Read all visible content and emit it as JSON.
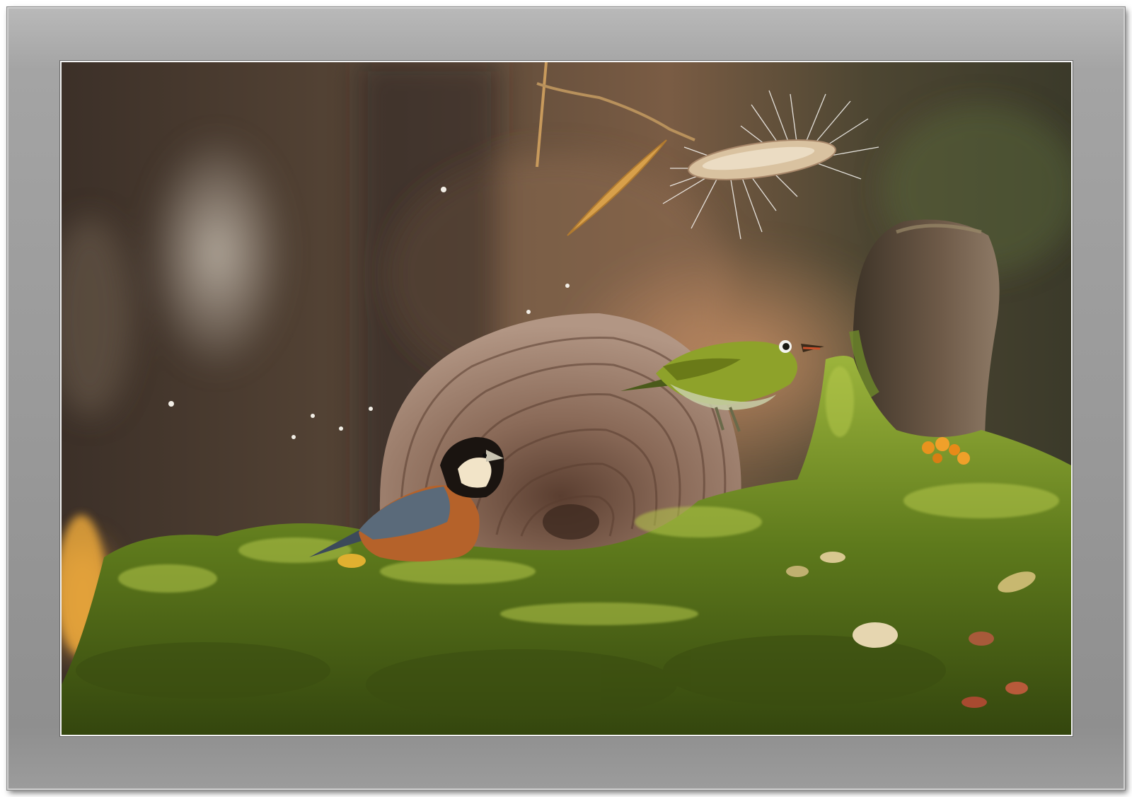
{
  "photo": {
    "subject": "",
    "colors": {
      "mat": "#9e9e9e",
      "moss": "#6c8a22",
      "background_bokeh": "#4a3a2c",
      "bracket_fungus": "#8a6a55",
      "white_eye": "#8aa22a",
      "tit_orange": "#b5622a"
    }
  }
}
